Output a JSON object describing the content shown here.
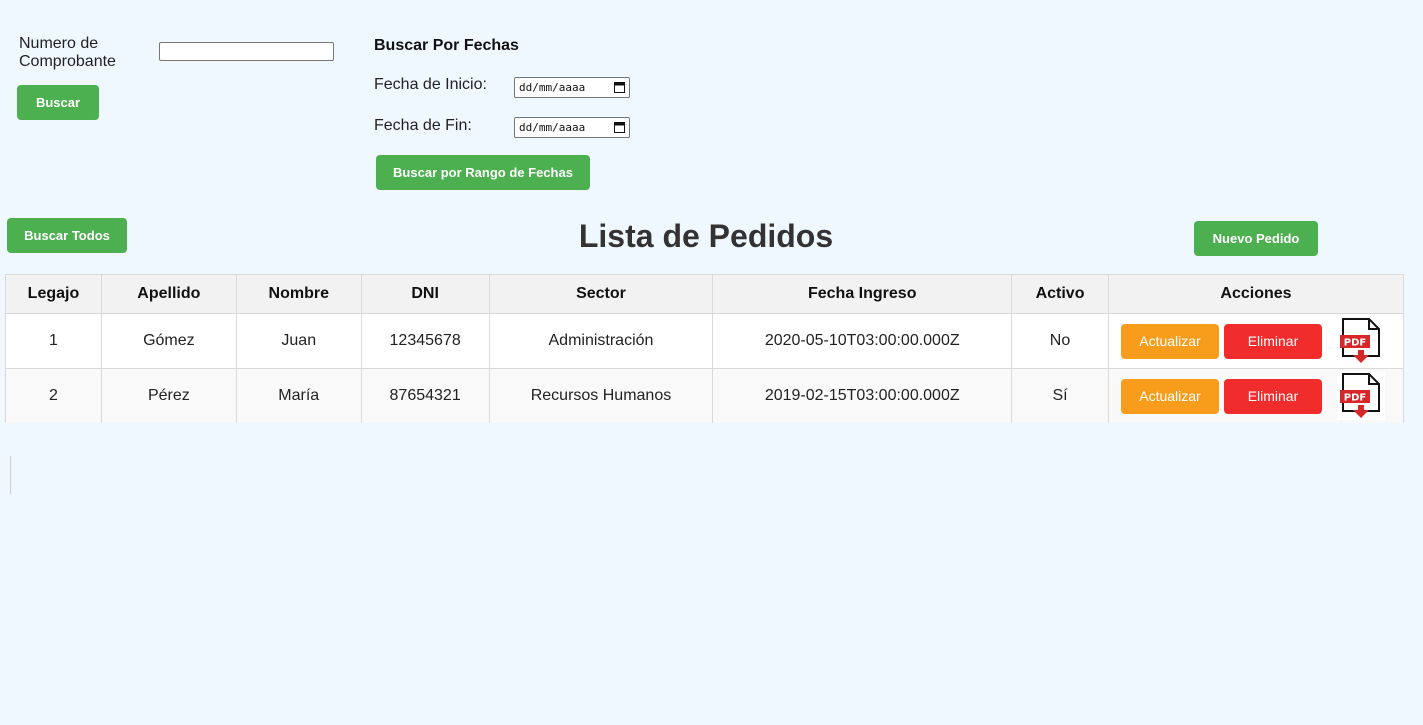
{
  "search": {
    "comprobante_label": "Numero de Comprobante",
    "comprobante_value": "",
    "buscar_label": "Buscar"
  },
  "dates": {
    "title": "Buscar Por Fechas",
    "start_label": "Fecha de Inicio:",
    "start_value": "dd/mm/aaaa",
    "end_label": "Fecha de Fin:",
    "end_value": "dd/mm/aaaa",
    "range_button": "Buscar por Rango de Fechas"
  },
  "toolbar": {
    "buscar_todos": "Buscar Todos",
    "title": "Lista de Pedidos",
    "nuevo_pedido": "Nuevo Pedido"
  },
  "table": {
    "headers": [
      "Legajo",
      "Apellido",
      "Nombre",
      "DNI",
      "Sector",
      "Fecha Ingreso",
      "Activo",
      "Acciones"
    ],
    "rows": [
      {
        "legajo": "1",
        "apellido": "Gómez",
        "nombre": "Juan",
        "dni": "12345678",
        "sector": "Administración",
        "fecha_ingreso": "2020-05-10T03:00:00.000Z",
        "activo": "No"
      },
      {
        "legajo": "2",
        "apellido": "Pérez",
        "nombre": "María",
        "dni": "87654321",
        "sector": "Recursos Humanos",
        "fecha_ingreso": "2019-02-15T03:00:00.000Z",
        "activo": "Sí"
      }
    ],
    "actions": {
      "update": "Actualizar",
      "delete": "Eliminar",
      "pdf_icon": "pdf-download-icon",
      "pdf_text": "PDF"
    }
  },
  "colors": {
    "background": "#f0f8ff",
    "green": "#4caf50",
    "orange": "#f89c1c",
    "red": "#f02c2c"
  }
}
